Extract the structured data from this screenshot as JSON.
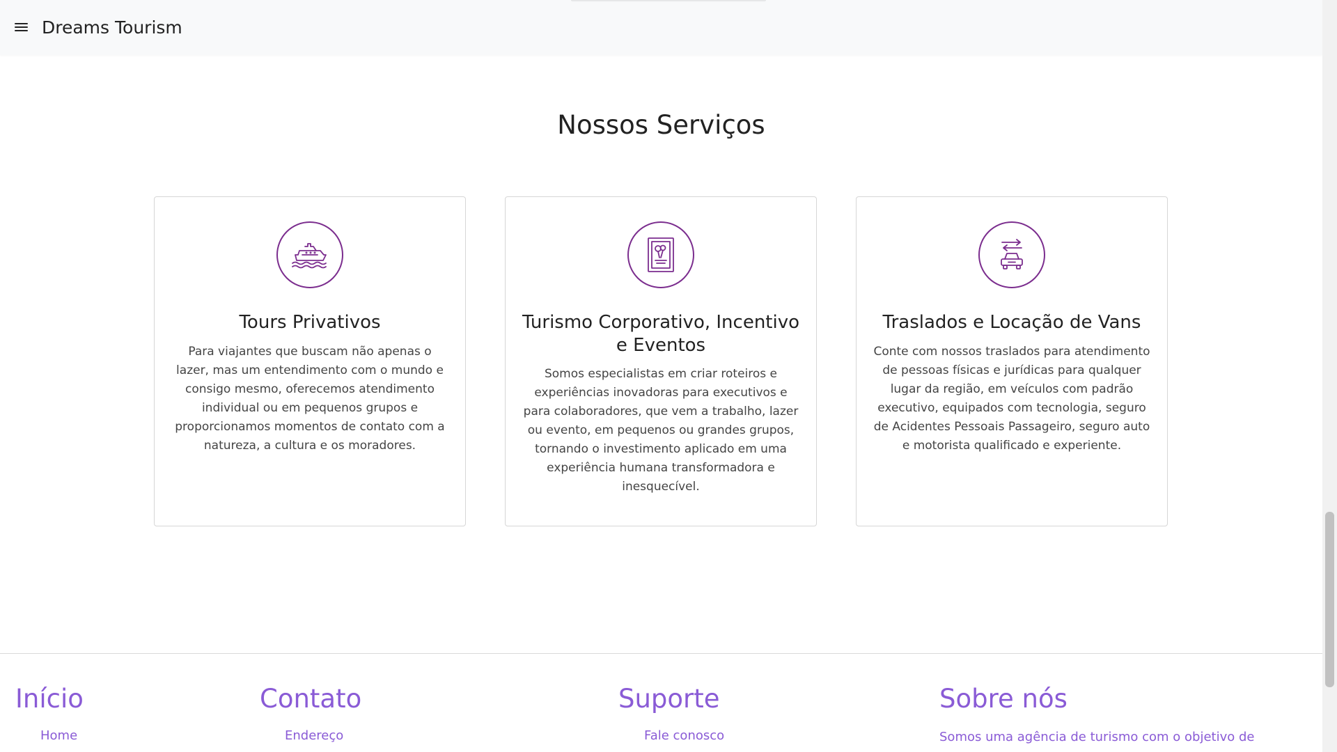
{
  "navbar": {
    "brand": "Dreams Tourism",
    "menu_icon": "hamburger-menu-icon"
  },
  "services": {
    "title": "Nossos Serviços",
    "accent_color": "#7b2d8e",
    "cards": [
      {
        "icon": "ship-icon",
        "title": "Tours Privativos",
        "text": "Para viajantes que buscam não apenas o lazer, mas um entendimento com o mundo e consigo mesmo, oferecemos atendimento individual ou em pequenos grupos e proporcionamos momentos de contato com a natureza, a cultura e os moradores."
      },
      {
        "icon": "event-poster-icon",
        "title": "Turismo Corporativo, Incentivo e Eventos",
        "text": "Somos especialistas em criar roteiros e experiências inovadoras para executivos e para colaboradores, que vem a trabalho, lazer ou evento, em pequenos ou grandes grupos, tornando o investimento aplicado em uma experiência humana transformadora e inesquecível."
      },
      {
        "icon": "car-transfer-icon",
        "title": "Traslados e Locação de Vans",
        "text": "Conte com nossos traslados para atendimento de pessoas físicas e jurídicas para qualquer lugar da região, em veículos com padrão executivo, equipados com tecnologia, seguro de Acidentes Pessoais Passageiro, seguro auto e motorista qualificado e experiente."
      }
    ]
  },
  "footer": {
    "accent_color": "#8a5bd6",
    "columns": [
      {
        "heading": "Início",
        "link": "Home"
      },
      {
        "heading": "Contato",
        "link": "Endereço"
      },
      {
        "heading": "Suporte",
        "link": "Fale conosco"
      },
      {
        "heading": "Sobre nós",
        "text": "Somos uma agência de turismo com o objetivo de"
      }
    ]
  }
}
